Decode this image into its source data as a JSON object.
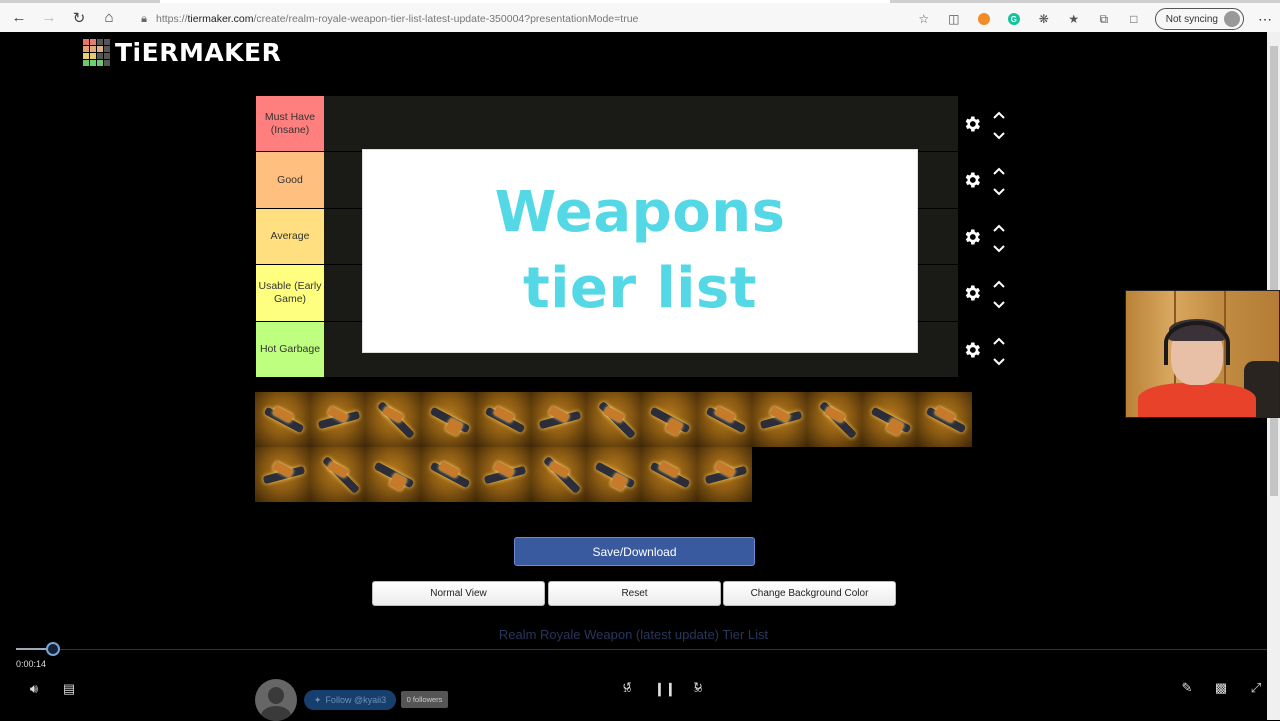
{
  "browser": {
    "url_prefix": "https://",
    "url_host": "tiermaker.com",
    "url_path": "/create/realm-royale-weapon-tier-list-latest-update-350004?presentationMode=true",
    "sync_label": "Not syncing",
    "icons": [
      "back-icon",
      "forward-icon",
      "refresh-icon",
      "home-icon",
      "lock-icon",
      "add-favorite-icon",
      "collections-icon",
      "extension-orange-icon",
      "grammarly-icon",
      "extensions-icon",
      "favorites-icon",
      "tab-actions-icon",
      "split-screen-icon",
      "profile-icon",
      "more-icon"
    ]
  },
  "site": {
    "logo_text": "TiERMAKER",
    "logo_colors": [
      "#e8736a",
      "#e07f6e",
      "#555",
      "#555",
      "#e8a070",
      "#e4a87a",
      "#e4b080",
      "#555",
      "#e8d070",
      "#e8c870",
      "#555",
      "#555",
      "#6cc86c",
      "#6cd06c",
      "#6cc86c",
      "#555"
    ]
  },
  "tiers": [
    {
      "label": "Must Have (Insane)",
      "color": "#ff7f7f"
    },
    {
      "label": "Good",
      "color": "#ffbf7f"
    },
    {
      "label": "Average",
      "color": "#ffdf7f"
    },
    {
      "label": "Usable (Early Game)",
      "color": "#ffff7f"
    },
    {
      "label": "Hot Garbage",
      "color": "#bfff7f"
    }
  ],
  "overlay": {
    "line1": "Weapons",
    "line2": "tier list"
  },
  "pool": {
    "row1_count": 13,
    "row2_count": 9
  },
  "buttons": {
    "save": "Save/Download",
    "normal_view": "Normal View",
    "reset": "Reset",
    "change_bg": "Change Background Color"
  },
  "list_title": "Realm Royale Weapon (latest update) Tier List",
  "player": {
    "time": "0:00:14",
    "progress_fraction": 0.03,
    "rewind_label": "10",
    "forward_label": "30"
  },
  "social": {
    "follow_label": "Follow @kyaii3",
    "followers_label": "0 followers"
  }
}
